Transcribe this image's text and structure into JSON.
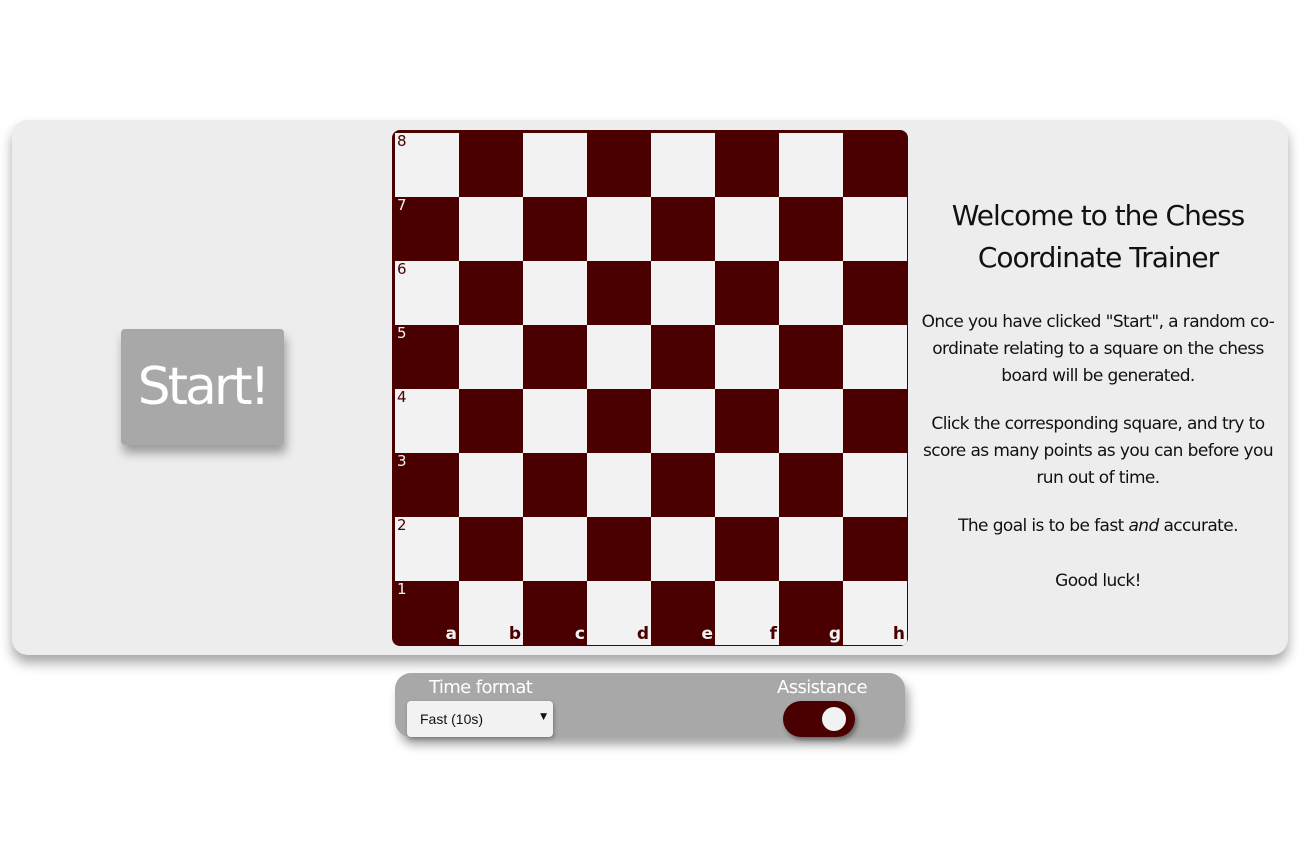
{
  "start_button": {
    "label": "Start!"
  },
  "board": {
    "ranks": [
      "8",
      "7",
      "6",
      "5",
      "4",
      "3",
      "2",
      "1"
    ],
    "files": [
      "a",
      "b",
      "c",
      "d",
      "e",
      "f",
      "g",
      "h"
    ],
    "light_color": "#f2f2f2",
    "dark_color": "#4a0000"
  },
  "info": {
    "title": "Welcome to the Chess Coordinate Trainer",
    "para1": "Once you have clicked \"Start\", a random co-ordinate relating to a square on the chess board will be generated.",
    "para2": "Click the corresponding square, and try to score as many points as you can before you run out of time.",
    "goal_prefix": "The goal is to be fast ",
    "goal_emphasis": "and",
    "goal_suffix": " accurate.",
    "good_luck": "Good luck!"
  },
  "controls": {
    "time_format_label": "Time format",
    "time_format_value": "Fast (10s)",
    "assistance_label": "Assistance",
    "assistance_on": true
  }
}
